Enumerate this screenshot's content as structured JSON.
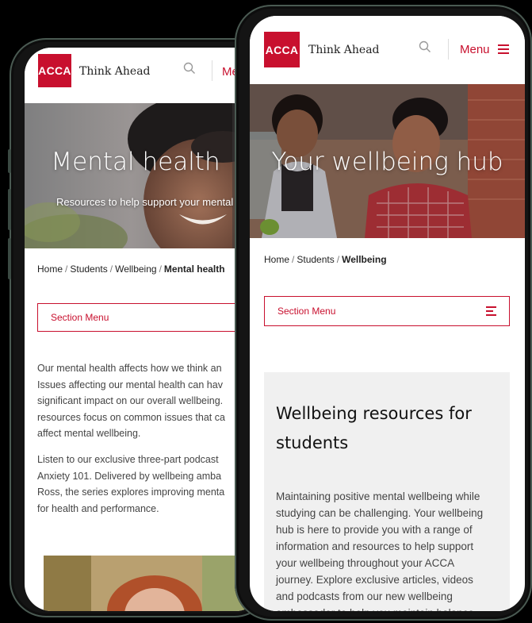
{
  "colors": {
    "brand": "#c8102e",
    "background": "#000000",
    "card": "#f0f0f0"
  },
  "back_screen": {
    "header": {
      "logo_text": "ACCA",
      "tagline": "Think Ahead",
      "menu_label": "Me",
      "search_icon": "search-icon"
    },
    "hero": {
      "title": "Mental health",
      "subtitle": "Resources to help support your mental h"
    },
    "breadcrumb": {
      "items": [
        "Home",
        "Students",
        "Wellbeing"
      ],
      "current": "Mental health"
    },
    "section_menu": {
      "label": "Section Menu"
    },
    "paragraphs": [
      [
        "Our mental health affects how we think an",
        "Issues affecting our mental health can hav",
        "significant impact on our overall wellbeing.",
        "resources focus on common issues that ca",
        "affect mental wellbeing."
      ],
      [
        "Listen to our exclusive three-part podcast",
        "Anxiety 101. Delivered by wellbeing amba",
        "Ross, the series explores improving menta",
        "for health and performance."
      ]
    ]
  },
  "front_screen": {
    "header": {
      "logo_text": "ACCA",
      "tagline": "Think Ahead",
      "menu_label": "Menu",
      "search_icon": "search-icon",
      "menu_icon": "hamburger-icon"
    },
    "hero": {
      "title": "Your wellbeing hub"
    },
    "breadcrumb": {
      "items": [
        "Home",
        "Students"
      ],
      "current": "Wellbeing"
    },
    "section_menu": {
      "label": "Section Menu",
      "icon": "list-icon"
    },
    "card": {
      "title_lines": [
        "Wellbeing resources for",
        "students"
      ],
      "text_lines": [
        "Maintaining positive mental wellbeing while",
        "studying can be challenging. Your wellbeing",
        "hub is here to provide you with a range of",
        "information and resources to help support",
        "your wellbeing throughout your ACCA",
        "journey. Explore exclusive articles, videos",
        "and podcasts from our new wellbeing",
        "ambassador to help you maintain balance"
      ]
    }
  }
}
